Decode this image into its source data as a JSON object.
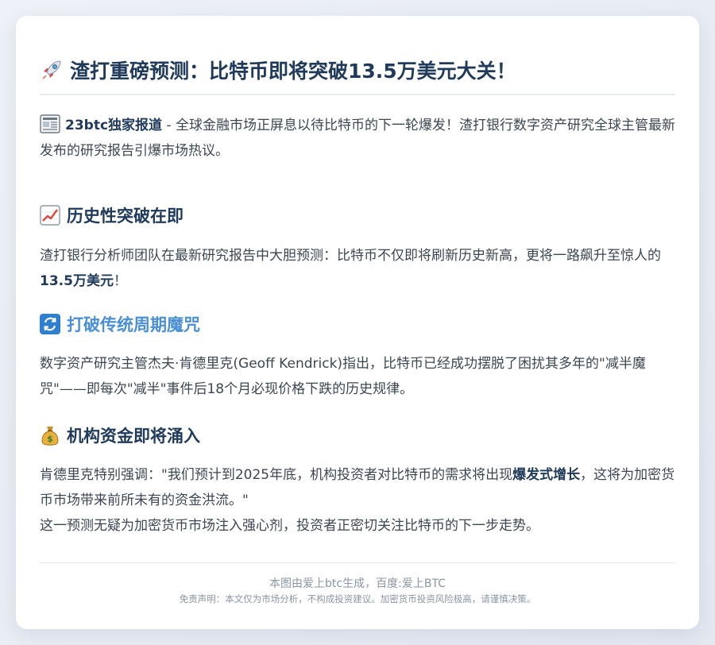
{
  "title": {
    "icon": "rocket-icon",
    "text": "渣打重磅预测：比特币即将突破13.5万美元大关！"
  },
  "intro": {
    "icon": "newspaper-icon",
    "strong": "23btc独家报道",
    "text": " - 全球金融市场正屏息以待比特币的下一轮爆发！渣打银行数字资产研究全球主管最新发布的研究报告引爆市场热议。"
  },
  "section1": {
    "icon": "chart-increasing-icon",
    "heading": "历史性突破在即",
    "text_before": "渣打银行分析师团队在最新研究报告中大胆预测：比特币不仅即将刷新历史新高，更将一路飙升至惊人的",
    "strong": "13.5万美元",
    "text_after": "！"
  },
  "section2": {
    "icon": "refresh-icon",
    "heading": "打破传统周期魔咒",
    "text": "数字资产研究主管杰夫·肯德里克(Geoff Kendrick)指出，比特币已经成功摆脱了困扰其多年的\"减半魔咒\"——即每次\"减半\"事件后18个月必现价格下跌的历史规律。"
  },
  "section3": {
    "icon": "money-bag-icon",
    "heading": "机构资金即将涌入",
    "text_before": "肯德里克特别强调：\"我们预计到2025年底，机构投资者对比特币的需求将出现",
    "strong": "爆发式增长",
    "text_after": "，这将为加密货币市场带来前所未有的资金洪流。\""
  },
  "closing": "这一预测无疑为加密货币市场注入强心剂，投资者正密切关注比特币的下一步走势。",
  "footer": {
    "credit": "本图由爱上btc生成，百度:爱上BTC",
    "disclaimer": "免责声明：本文仅为市场分析，不构成投资建议。加密货币投资风险极高，请谨慎决策。"
  },
  "colors": {
    "heading": "#1f3a5a",
    "accent_blue": "#4b8fd6",
    "body_text": "#3c4652",
    "footer_text": "#8a95a3"
  }
}
